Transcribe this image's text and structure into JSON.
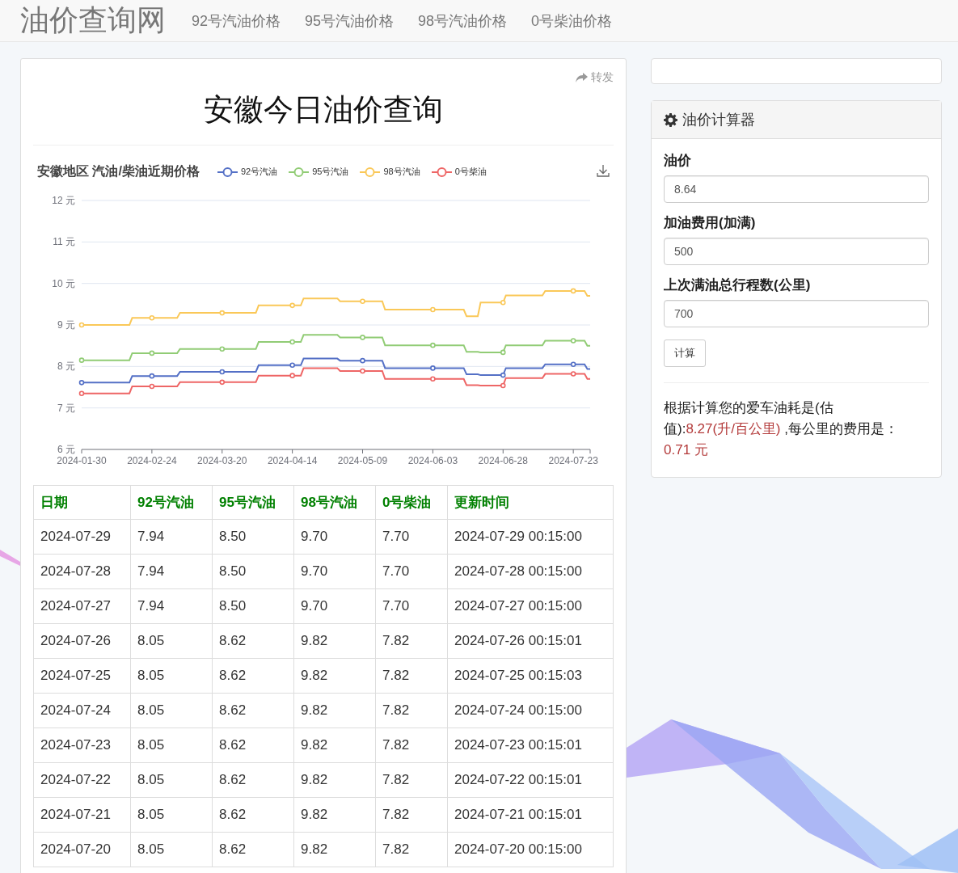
{
  "navbar": {
    "logo": "油价查询网",
    "links": [
      "92号汽油价格",
      "95号汽油价格",
      "98号汽油价格",
      "0号柴油价格"
    ]
  },
  "main": {
    "share": "转发",
    "title": "安徽今日油价查询",
    "chart": {
      "chart_data": {
        "type": "line",
        "title": "安徽地区 汽油/柴油近期价格",
        "grid": true,
        "x": [
          "2024-01-30",
          "2024-02-16",
          "2024-02-17",
          "2024-02-24",
          "2024-03-04",
          "2024-03-05",
          "2024-03-20",
          "2024-04-01",
          "2024-04-02",
          "2024-04-14",
          "2024-04-17",
          "2024-04-18",
          "2024-04-30",
          "2024-05-01",
          "2024-05-09",
          "2024-05-16",
          "2024-05-17",
          "2024-06-03",
          "2024-06-14",
          "2024-06-15",
          "2024-06-19",
          "2024-06-20",
          "2024-06-28",
          "2024-06-29",
          "2024-07-12",
          "2024-07-13",
          "2024-07-23",
          "2024-07-27",
          "2024-07-28",
          "2024-07-29"
        ],
        "series": [
          {
            "name": "92号汽油",
            "color": "#5470c6",
            "values": [
              7.61,
              7.61,
              7.77,
              7.77,
              7.77,
              7.87,
              7.87,
              7.87,
              8.03,
              8.03,
              8.03,
              8.19,
              8.19,
              8.14,
              8.14,
              8.14,
              7.96,
              7.96,
              7.96,
              7.81,
              7.81,
              7.79,
              7.79,
              7.96,
              7.96,
              8.05,
              8.05,
              8.05,
              7.94,
              7.94
            ]
          },
          {
            "name": "95号汽油",
            "color": "#91cc75",
            "values": [
              8.15,
              8.15,
              8.32,
              8.32,
              8.32,
              8.42,
              8.42,
              8.42,
              8.59,
              8.59,
              8.59,
              8.76,
              8.76,
              8.7,
              8.7,
              8.7,
              8.51,
              8.51,
              8.51,
              8.35,
              8.35,
              8.34,
              8.34,
              8.51,
              8.51,
              8.62,
              8.62,
              8.62,
              8.5,
              8.5
            ]
          },
          {
            "name": "98号汽油",
            "color": "#fac858",
            "values": [
              9.0,
              9.0,
              9.17,
              9.17,
              9.17,
              9.29,
              9.29,
              9.29,
              9.47,
              9.47,
              9.47,
              9.64,
              9.64,
              9.57,
              9.57,
              9.57,
              9.37,
              9.37,
              9.37,
              9.21,
              9.21,
              9.54,
              9.54,
              9.71,
              9.71,
              9.82,
              9.82,
              9.82,
              9.7,
              9.7
            ]
          },
          {
            "name": "0号柴油",
            "color": "#ee6666",
            "values": [
              7.35,
              7.35,
              7.52,
              7.52,
              7.52,
              7.62,
              7.62,
              7.62,
              7.78,
              7.78,
              7.78,
              7.96,
              7.96,
              7.89,
              7.89,
              7.89,
              7.7,
              7.7,
              7.7,
              7.55,
              7.55,
              7.54,
              7.54,
              7.72,
              7.72,
              7.82,
              7.82,
              7.82,
              7.7,
              7.7
            ]
          }
        ],
        "xlim": [
          "2024-01-30",
          "2024-07-29"
        ],
        "ylim": [
          6,
          12
        ],
        "xticks": [
          "2024-01-30",
          "2024-02-24",
          "2024-03-20",
          "2024-04-14",
          "2024-05-09",
          "2024-06-03",
          "2024-06-28",
          "2024-07-23"
        ],
        "yticks": [
          {
            "value": 6,
            "label": "6 元"
          },
          {
            "value": 7,
            "label": "7 元"
          },
          {
            "value": 8,
            "label": "8 元"
          },
          {
            "value": 9,
            "label": "9 元"
          },
          {
            "value": 10,
            "label": "10 元"
          },
          {
            "value": 11,
            "label": "11 元"
          },
          {
            "value": 12,
            "label": "12 元"
          }
        ]
      }
    },
    "table": {
      "columns": [
        "日期",
        "92号汽油",
        "95号汽油",
        "98号汽油",
        "0号柴油",
        "更新时间"
      ],
      "rows": [
        [
          "2024-07-29",
          "7.94",
          "8.50",
          "9.70",
          "7.70",
          "2024-07-29 00:15:00"
        ],
        [
          "2024-07-28",
          "7.94",
          "8.50",
          "9.70",
          "7.70",
          "2024-07-28 00:15:00"
        ],
        [
          "2024-07-27",
          "7.94",
          "8.50",
          "9.70",
          "7.70",
          "2024-07-27 00:15:00"
        ],
        [
          "2024-07-26",
          "8.05",
          "8.62",
          "9.82",
          "7.82",
          "2024-07-26 00:15:01"
        ],
        [
          "2024-07-25",
          "8.05",
          "8.62",
          "9.82",
          "7.82",
          "2024-07-25 00:15:03"
        ],
        [
          "2024-07-24",
          "8.05",
          "8.62",
          "9.82",
          "7.82",
          "2024-07-24 00:15:00"
        ],
        [
          "2024-07-23",
          "8.05",
          "8.62",
          "9.82",
          "7.82",
          "2024-07-23 00:15:01"
        ],
        [
          "2024-07-22",
          "8.05",
          "8.62",
          "9.82",
          "7.82",
          "2024-07-22 00:15:01"
        ],
        [
          "2024-07-21",
          "8.05",
          "8.62",
          "9.82",
          "7.82",
          "2024-07-21 00:15:01"
        ],
        [
          "2024-07-20",
          "8.05",
          "8.62",
          "9.82",
          "7.82",
          "2024-07-20 00:15:00"
        ]
      ]
    }
  },
  "calculator": {
    "title": "油价计算器",
    "fields": [
      {
        "label": "油价",
        "value": "8.64"
      },
      {
        "label": "加油费用(加满)",
        "value": "500"
      },
      {
        "label": "上次满油总行程数(公里)",
        "value": "700"
      }
    ],
    "button": "计算",
    "result": [
      {
        "text": "根据计算您的爱车油耗是(估值):",
        "highlight": false
      },
      {
        "text": "8.27(升/百公里)",
        "highlight": true
      },
      {
        "text": " ,每公里的费用是： ",
        "highlight": false
      },
      {
        "text": "0.71 元",
        "highlight": true
      }
    ]
  }
}
